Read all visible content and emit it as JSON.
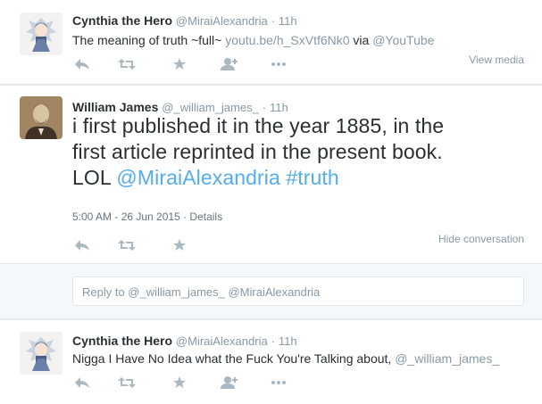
{
  "tweet1": {
    "name": "Cynthia the Hero",
    "handle": "@MiraiAlexandria",
    "dot": "·",
    "time": "11h",
    "text_pre": "The meaning of truth ~full~ ",
    "link": "youtu.be/h_SxVtf6Nk0",
    "text_via": " via ",
    "mention": "@YouTube",
    "view_media": "View media"
  },
  "tweet2": {
    "name": "William James",
    "handle": "@_william_james_",
    "dot": "·",
    "time": "11h",
    "text_line1": "i first published it in the year 1885, in the",
    "text_line2": "first article reprinted in the present book.",
    "text_lol": "LOL ",
    "mention": "@MiraiAlexandria",
    "hashtag": " #truth",
    "timestamp": "5:00 AM - 26 Jun 2015",
    "details_sep": " · ",
    "details": "Details",
    "hide_conversation": "Hide conversation"
  },
  "reply": {
    "placeholder": "Reply to @_william_james_ @MiraiAlexandria"
  },
  "tweet3": {
    "name": "Cynthia the Hero",
    "handle": "@MiraiAlexandria",
    "dot": "·",
    "time": "11h",
    "text_pre": "Nigga I Have No Idea what the Fuck You're Talking about, ",
    "mention": "@_william_james_"
  },
  "icons": [
    "reply-icon",
    "retweet-icon",
    "favorite-icon",
    "follow-icon",
    "more-icon"
  ],
  "colors": {
    "link_blue": "#55acee",
    "muted": "#8899a6",
    "icon": "#aab8c2"
  }
}
